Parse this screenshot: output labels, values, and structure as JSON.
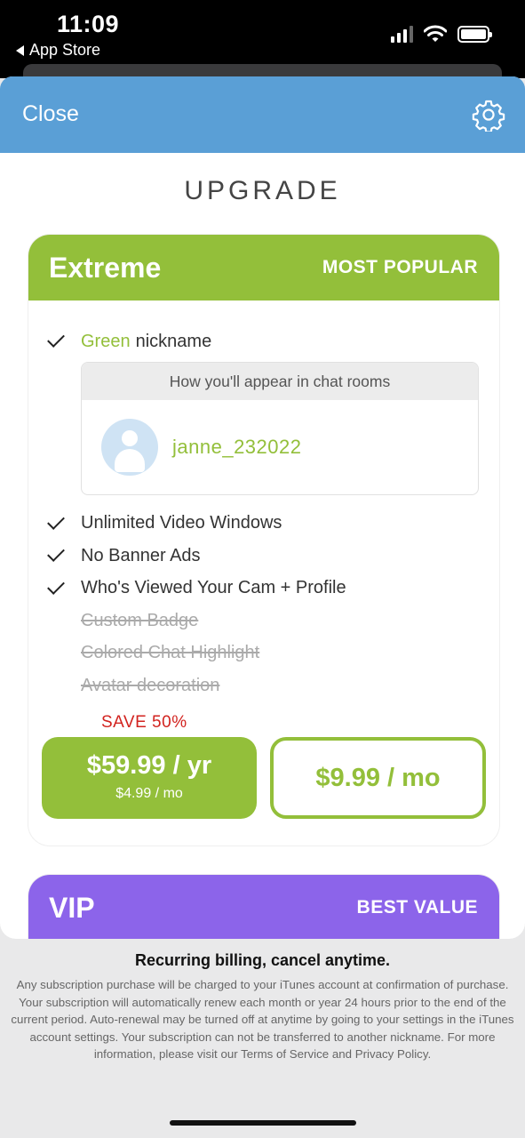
{
  "status_bar": {
    "time": "11:09",
    "back_label": "App Store"
  },
  "nav": {
    "close_label": "Close"
  },
  "page": {
    "title": "UPGRADE"
  },
  "extreme": {
    "name": "Extreme",
    "tag": "MOST POPULAR",
    "nickname_feature": {
      "highlight": "Green",
      "rest": "nickname"
    },
    "preview": {
      "header": "How you'll appear in chat rooms",
      "username": "janne_232022"
    },
    "features": [
      "Unlimited Video Windows",
      "No Banner Ads",
      "Who's Viewed Your Cam + Profile"
    ],
    "disabled_features": [
      "Custom Badge",
      "Colored Chat Highlight",
      "Avatar decoration"
    ],
    "save_label": "SAVE 50%",
    "yearly": {
      "price": "$59.99 / yr",
      "per_month": "$4.99 / mo"
    },
    "monthly": {
      "price": "$9.99 / mo"
    }
  },
  "vip": {
    "name": "VIP",
    "tag": "BEST VALUE"
  },
  "footer": {
    "title": "Recurring billing, cancel anytime.",
    "legal": "Any subscription purchase will be charged to your iTunes account at confirmation of purchase. Your subscription will automatically renew each month or year 24 hours prior to the end of the current period. Auto-renewal may be turned off at anytime by going to your settings in the iTunes account settings. Your subscription can not be transferred to another nickname. For more information, please visit our Terms of Service and Privacy Policy."
  },
  "colors": {
    "nav_blue": "#5a9fd6",
    "extreme_green": "#93bf3a",
    "vip_purple": "#8c64ea",
    "save_red": "#d2231f"
  },
  "icons": [
    "back-arrow-icon",
    "cellular-signal-icon",
    "wifi-icon",
    "battery-icon",
    "gear-icon",
    "checkmark-icon",
    "avatar-icon"
  ]
}
